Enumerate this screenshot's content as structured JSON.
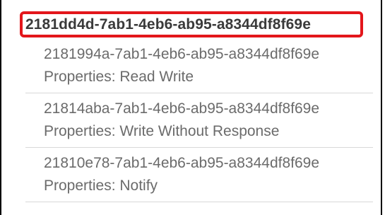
{
  "service": {
    "uuid": "2181dd4d-7ab1-4eb6-ab95-a8344df8f69e",
    "highlight_color": "#e3161b"
  },
  "characteristics": [
    {
      "uuid": "2181994a-7ab1-4eb6-ab95-a8344df8f69e",
      "properties": "Properties: Read Write"
    },
    {
      "uuid": "21814aba-7ab1-4eb6-ab95-a8344df8f69e",
      "properties": "Properties: Write Without Response"
    },
    {
      "uuid": "21810e78-7ab1-4eb6-ab95-a8344df8f69e",
      "properties": "Properties: Notify"
    }
  ],
  "colors": {
    "text_primary": "#3a3a3a",
    "text_secondary": "#6b6b6b",
    "divider": "#d8d8d8",
    "frame_border": "#000000"
  }
}
